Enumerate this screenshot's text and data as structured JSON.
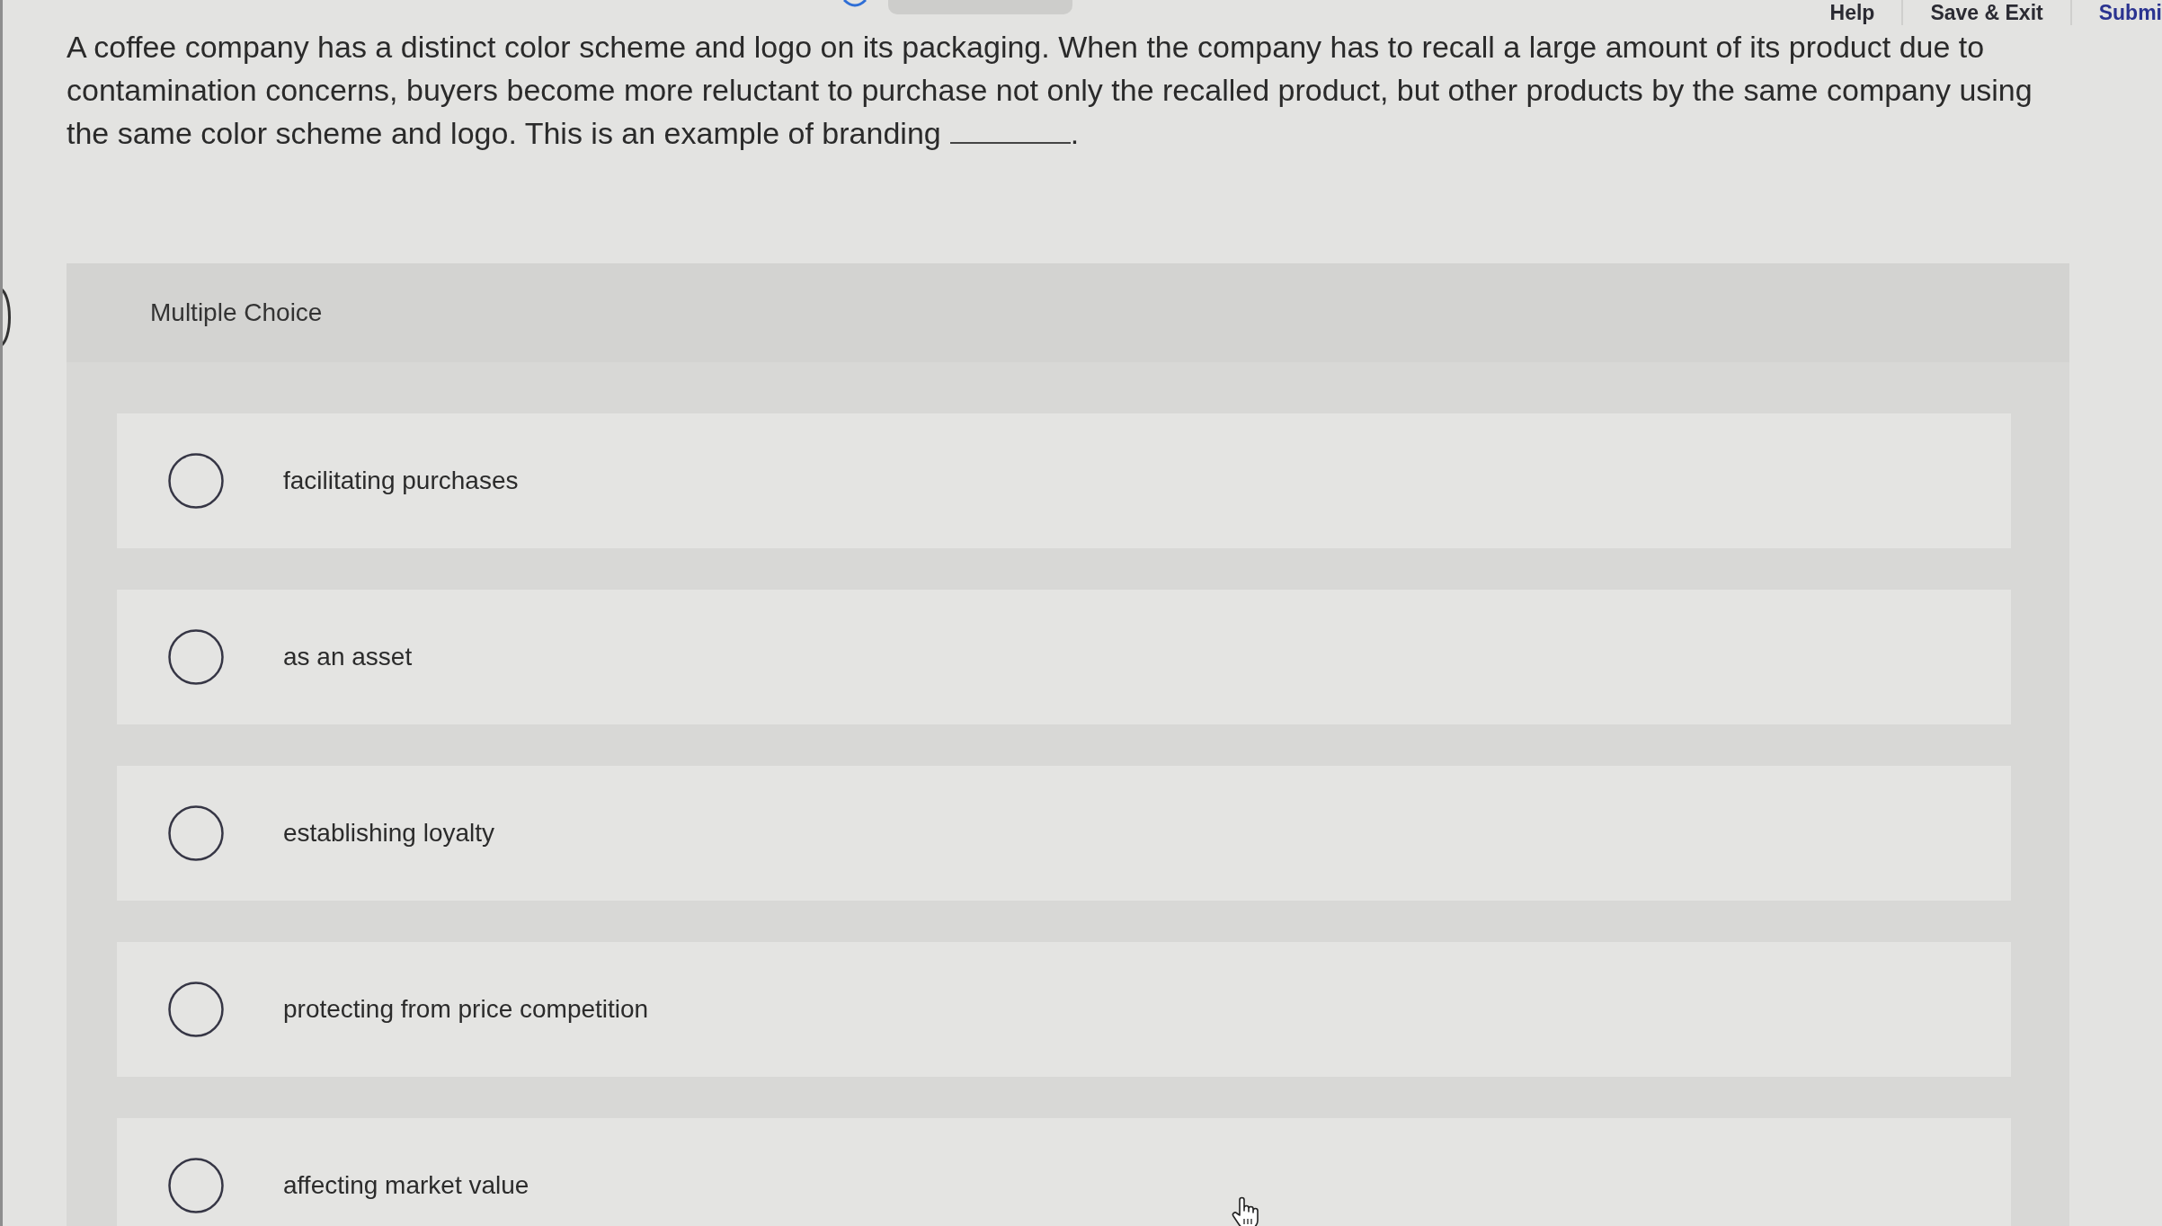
{
  "toolbar": {
    "links": [
      {
        "label": "Help",
        "kind": "plain"
      },
      {
        "label": "Save & Exit",
        "kind": "plain"
      },
      {
        "label": "Submi",
        "kind": "primary"
      }
    ]
  },
  "question": {
    "parts": [
      {
        "kind": "text",
        "text": "A coffee company has a distinct color scheme and logo on its packaging. When the company has to recall a large amount of its product due to contamination concerns, buyers become more reluctant to purchase not only the recalled product, but other products by the same company using the same color scheme and logo. This is an example of branding"
      },
      {
        "kind": "blank"
      },
      {
        "kind": "text",
        "text": "."
      }
    ]
  },
  "multiple_choice": {
    "heading": "Multiple Choice",
    "options": [
      {
        "label": "facilitating purchases",
        "selected": false
      },
      {
        "label": "as an asset",
        "selected": false
      },
      {
        "label": "establishing loyalty",
        "selected": false
      },
      {
        "label": "protecting from price competition",
        "selected": false
      },
      {
        "label": "affecting market value",
        "selected": false
      }
    ]
  }
}
